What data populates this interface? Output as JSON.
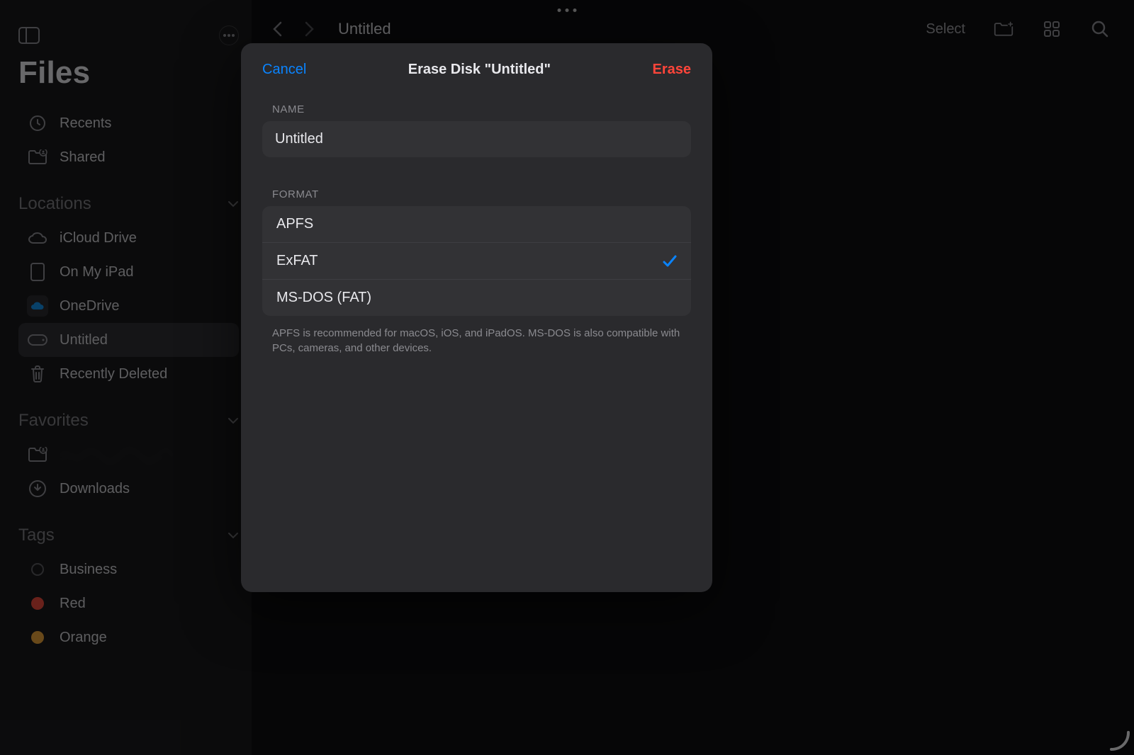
{
  "sidebar": {
    "app_title": "Files",
    "items_top": [
      {
        "label": "Recents",
        "icon": "clock-icon"
      },
      {
        "label": "Shared",
        "icon": "shared-folder-icon"
      }
    ],
    "sections": {
      "locations": {
        "title": "Locations",
        "items": [
          {
            "label": "iCloud Drive",
            "icon": "cloud-icon"
          },
          {
            "label": "On My iPad",
            "icon": "ipad-icon"
          },
          {
            "label": "OneDrive",
            "icon": "onedrive-icon"
          },
          {
            "label": "Untitled",
            "icon": "drive-icon",
            "active": true
          },
          {
            "label": "Recently Deleted",
            "icon": "trash-icon"
          }
        ]
      },
      "favorites": {
        "title": "Favorites",
        "items": [
          {
            "label": "",
            "icon": "folder-person-icon",
            "redacted": true
          },
          {
            "label": "Downloads",
            "icon": "download-circle-icon"
          }
        ]
      },
      "tags": {
        "title": "Tags",
        "items": [
          {
            "label": "Business",
            "color": "empty"
          },
          {
            "label": "Red",
            "color": "red"
          },
          {
            "label": "Orange",
            "color": "orange"
          }
        ]
      }
    }
  },
  "content_header": {
    "title": "Untitled",
    "select_label": "Select"
  },
  "modal": {
    "cancel_label": "Cancel",
    "title": "Erase Disk \"Untitled\"",
    "erase_label": "Erase",
    "name_section_label": "NAME",
    "name_value": "Untitled",
    "format_section_label": "FORMAT",
    "formats": [
      {
        "label": "APFS",
        "selected": false
      },
      {
        "label": "ExFAT",
        "selected": true
      },
      {
        "label": "MS-DOS (FAT)",
        "selected": false
      }
    ],
    "help_text": "APFS is recommended for macOS, iOS, and iPadOS. MS-DOS is also compatible with PCs, cameras, and other devices."
  },
  "colors": {
    "accent_blue": "#0a84ff",
    "destructive_red": "#ff453a"
  }
}
